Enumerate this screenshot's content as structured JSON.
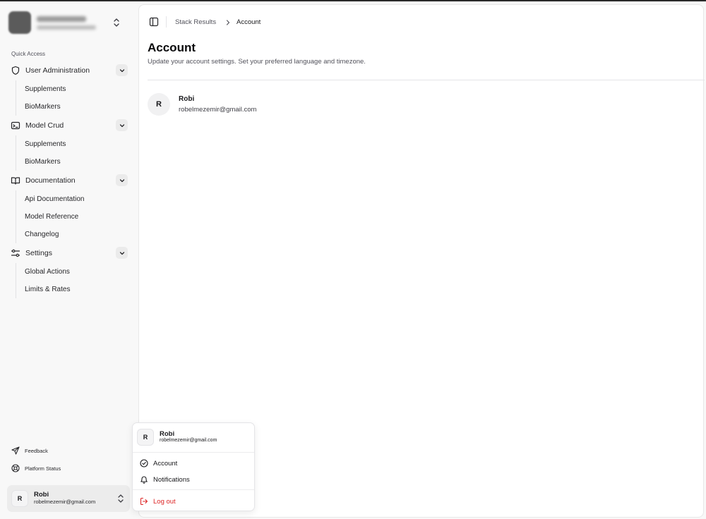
{
  "sidebar": {
    "group_label": "Quick Access",
    "sections": [
      {
        "label": "User Administration",
        "icon": "shield-icon",
        "items": [
          "Supplements",
          "BioMarkers"
        ]
      },
      {
        "label": "Model Crud",
        "icon": "terminal-icon",
        "items": [
          "Supplements",
          "BioMarkers"
        ]
      },
      {
        "label": "Documentation",
        "icon": "book-open-icon",
        "items": [
          "Api Documentation",
          "Model Reference",
          "Changelog"
        ]
      },
      {
        "label": "Settings",
        "icon": "sliders-icon",
        "items": [
          "Global Actions",
          "Limits & Rates"
        ]
      }
    ],
    "footer": [
      {
        "label": "Feedback",
        "icon": "send-icon"
      },
      {
        "label": "Platform Status",
        "icon": "life-buoy-icon"
      }
    ],
    "user": {
      "initial": "R",
      "name": "Robi",
      "email": "robelmezemir@gmail.com"
    }
  },
  "header": {
    "breadcrumb": [
      "Stack Results",
      "Account"
    ]
  },
  "page": {
    "title": "Account",
    "subtitle": "Update your account settings. Set your preferred language and timezone.",
    "profile": {
      "initial": "R",
      "name": "Robi",
      "email": "robelmezemir@gmail.com"
    }
  },
  "user_menu": {
    "initial": "R",
    "name": "Robi",
    "email": "robelmezemir@gmail.com",
    "items": [
      {
        "label": "Account",
        "icon": "badge-check-icon"
      },
      {
        "label": "Notifications",
        "icon": "bell-icon"
      }
    ],
    "logout": {
      "label": "Log out",
      "icon": "log-out-icon",
      "color": "#dc2626"
    }
  }
}
